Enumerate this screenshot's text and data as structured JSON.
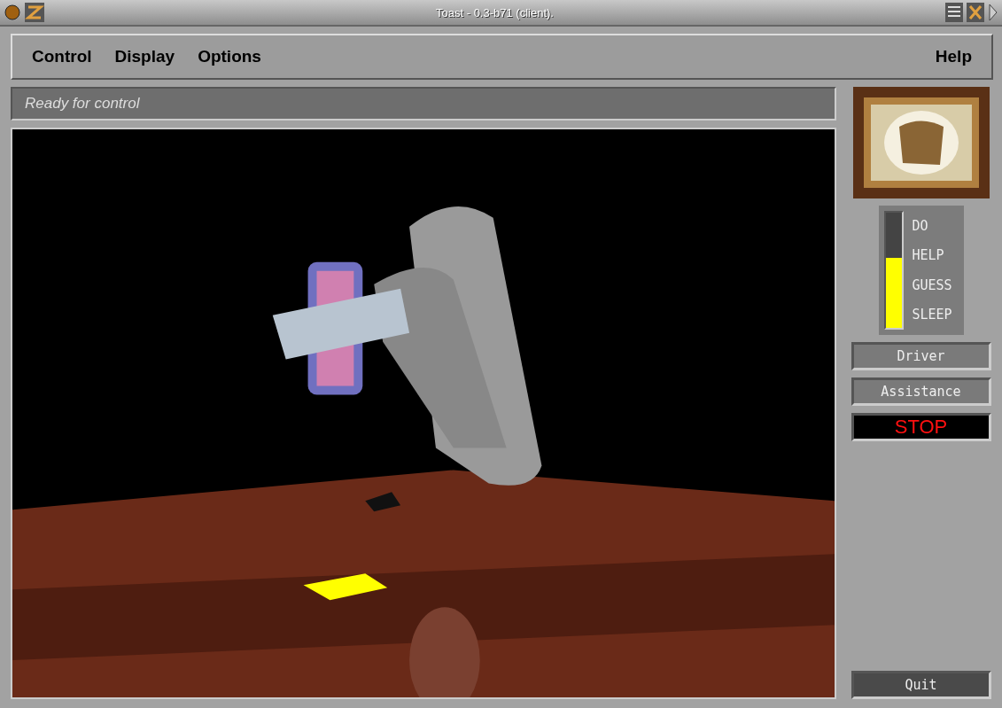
{
  "window": {
    "title": "Toast - 0.3-b71 (client)."
  },
  "menu": {
    "items": [
      "Control",
      "Display",
      "Options"
    ],
    "help": "Help"
  },
  "status": "Ready for control",
  "sidebar": {
    "meter": {
      "level": 0.61,
      "labels": [
        "DO",
        "HELP",
        "GUESS",
        "SLEEP"
      ]
    },
    "buttons": [
      {
        "label": "Driver",
        "kind": "normal"
      },
      {
        "label": "Assistance",
        "kind": "normal"
      },
      {
        "label": "STOP",
        "kind": "stop"
      }
    ],
    "quit": "Quit"
  }
}
